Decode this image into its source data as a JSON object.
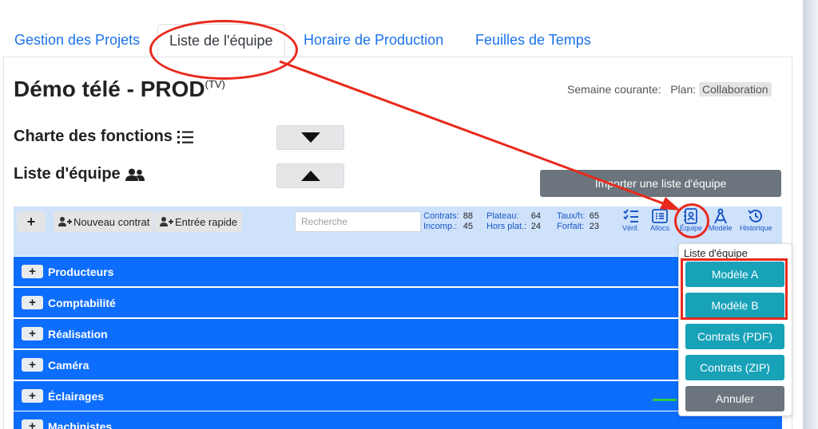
{
  "tabs": [
    {
      "label": "Gestion des Projets"
    },
    {
      "label": "Liste de l'équipe"
    },
    {
      "label": "Horaire de Production"
    },
    {
      "label": "Feuilles de Temps"
    }
  ],
  "page": {
    "title": "Démo télé - PROD",
    "title_sup": "(TV)",
    "week_label": "Semaine courante:",
    "plan_label": "Plan:",
    "plan_value": "Collaboration"
  },
  "sections": {
    "chart_label": "Charte des fonctions",
    "team_label": "Liste d'équipe"
  },
  "import_button": "Importer une liste d'équipe",
  "toolbar": {
    "add_label": "+",
    "new_contract": "Nouveau contrat",
    "quick_entry": "Entrée rapide",
    "search_placeholder": "Recherche",
    "stats": {
      "contrats_label": "Contrats:",
      "contrats_value": "88",
      "incomp_label": "Incomp.:",
      "incomp_value": "45",
      "plateau_label": "Plateau:",
      "plateau_value": "64",
      "horsplat_label": "Hors plat.:",
      "horsplat_value": "24",
      "taux_label": "Taux/h:",
      "taux_value": "65",
      "forfait_label": "Forfait:",
      "forfait_value": "23"
    },
    "icons": [
      {
        "label": "Vérif.",
        "icon": "checklist-icon"
      },
      {
        "label": "Allocs",
        "icon": "list-icon"
      },
      {
        "label": "Équipe",
        "icon": "contact-book-icon"
      },
      {
        "label": "Modèle",
        "icon": "drafting-compass-icon"
      },
      {
        "label": "Historique",
        "icon": "history-icon"
      }
    ]
  },
  "departments": [
    {
      "label": "Producteurs"
    },
    {
      "label": "Comptabilité"
    },
    {
      "label": "Réalisation"
    },
    {
      "label": "Caméra"
    },
    {
      "label": "Éclairages"
    },
    {
      "label": "Machinistes"
    }
  ],
  "dropdown": {
    "header": "Liste d'équipe",
    "items": [
      {
        "label": "Modèle A"
      },
      {
        "label": "Modèle B"
      },
      {
        "label": "Contrats (PDF)"
      },
      {
        "label": "Contrats (ZIP)"
      },
      {
        "label": "Annuler"
      }
    ]
  },
  "colors": {
    "accent": "#0d6efd",
    "tab_link": "#1a73e8",
    "toolbar_bg": "#cfe2fb",
    "teal_button": "#17a2b8",
    "gray_button": "#6c757d",
    "annotation_red": "#e8291c"
  }
}
